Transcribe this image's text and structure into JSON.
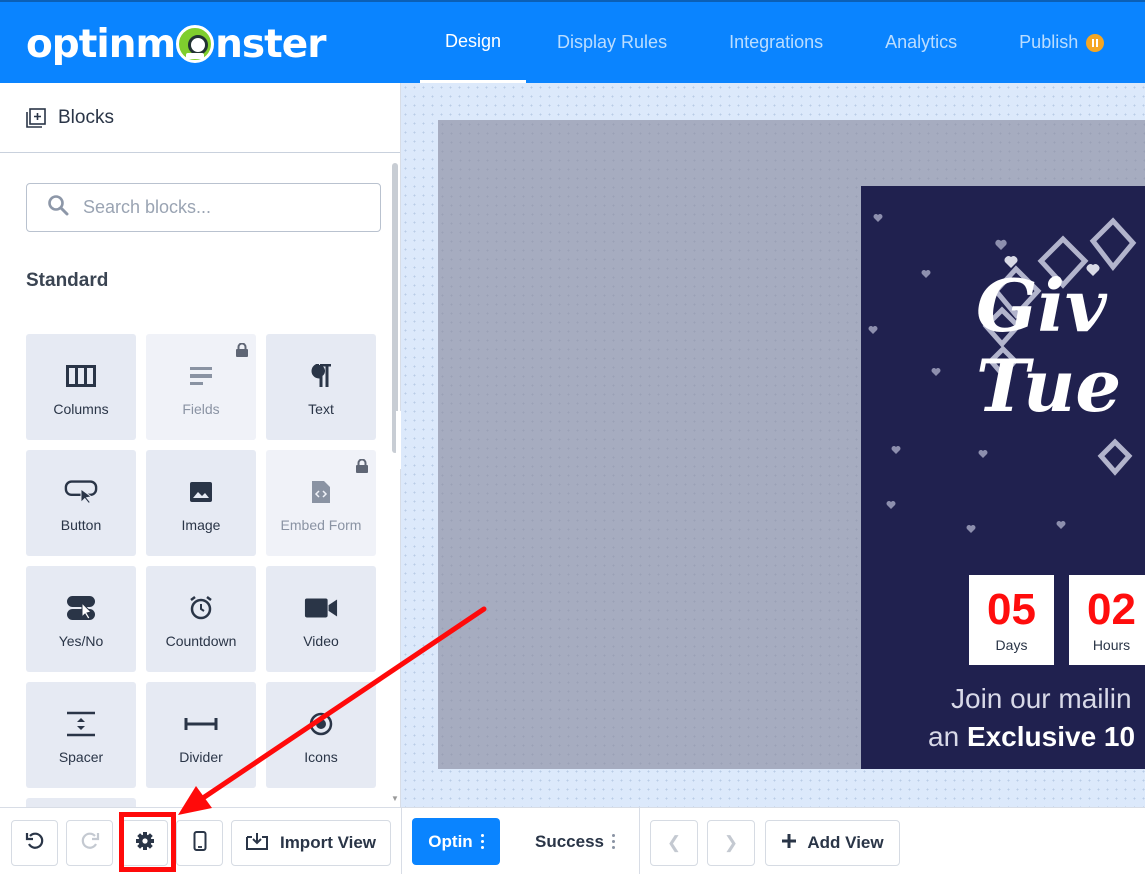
{
  "app": {
    "logo_text_left": "optinm",
    "logo_text_right": "nster",
    "colors": {
      "brand_blue": "#0a84ff",
      "annotation_red": "#ff0a0a",
      "popup_bg": "#20214f",
      "countdown_red": "#ff0d0d"
    }
  },
  "nav": {
    "tabs": [
      {
        "label": "Design",
        "active": true
      },
      {
        "label": "Display Rules",
        "active": false
      },
      {
        "label": "Integrations",
        "active": false
      },
      {
        "label": "Analytics",
        "active": false
      },
      {
        "label": "Publish",
        "active": false,
        "badge": "pause-icon"
      }
    ]
  },
  "sidebar": {
    "title": "Blocks",
    "search_placeholder": "Search blocks...",
    "section_title": "Standard",
    "blocks": [
      {
        "label": "Columns",
        "icon": "columns-icon",
        "locked": false
      },
      {
        "label": "Fields",
        "icon": "fields-icon",
        "locked": true
      },
      {
        "label": "Text",
        "icon": "paragraph-icon",
        "locked": false
      },
      {
        "label": "Button",
        "icon": "button-icon",
        "locked": false
      },
      {
        "label": "Image",
        "icon": "image-icon",
        "locked": false
      },
      {
        "label": "Embed Form",
        "icon": "embed-form-icon",
        "locked": true
      },
      {
        "label": "Yes/No",
        "icon": "yes-no-icon",
        "locked": false
      },
      {
        "label": "Countdown",
        "icon": "alarm-clock-icon",
        "locked": false
      },
      {
        "label": "Video",
        "icon": "video-camera-icon",
        "locked": false
      },
      {
        "label": "Spacer",
        "icon": "spacer-icon",
        "locked": false
      },
      {
        "label": "Divider",
        "icon": "divider-icon",
        "locked": false
      },
      {
        "label": "Icons",
        "icon": "target-icon",
        "locked": false
      }
    ]
  },
  "popup": {
    "headline_line1": "Giv",
    "headline_line2": "Tue",
    "countdown": [
      {
        "value": "05",
        "label": "Days"
      },
      {
        "value": "02",
        "label": "Hours"
      }
    ],
    "body_line1": "Join our mailin",
    "body_line2_prefix": "an ",
    "body_line2_bold": "Exclusive 10"
  },
  "bottombar": {
    "import_label": "Import View",
    "views": [
      {
        "label": "Optin",
        "active": true
      },
      {
        "label": "Success",
        "active": false
      }
    ],
    "add_view_label": "Add View"
  }
}
